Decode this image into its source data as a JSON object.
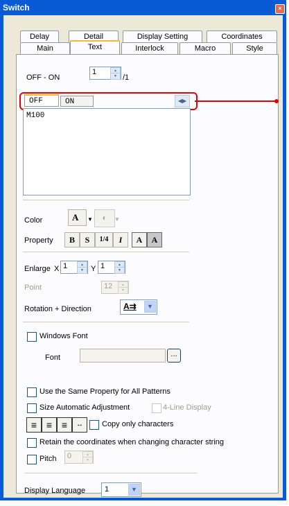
{
  "window": {
    "title": "Switch",
    "close_glyph": "×"
  },
  "tabs_row1": [
    "Delay",
    "Detail",
    "Display Setting",
    "Coordinates"
  ],
  "tabs_row2": [
    "Main",
    "Text",
    "Interlock",
    "Macro",
    "Style"
  ],
  "active_tab": "Text",
  "off_on": {
    "label": "OFF - ON",
    "value": "1",
    "total": "/1"
  },
  "subtabs": [
    "OFF",
    "ON"
  ],
  "text_content": "M100",
  "color": {
    "label": "Color",
    "font_glyph": "A"
  },
  "property": {
    "label": "Property",
    "buttons": [
      "B",
      "S",
      "1/4",
      "I",
      "A",
      "A"
    ]
  },
  "enlarge": {
    "label": "Enlarge",
    "x_label": "X",
    "x_value": "1",
    "y_label": "Y",
    "y_value": "1"
  },
  "point": {
    "label": "Point",
    "value": "12"
  },
  "rotation": {
    "label": "Rotation + Direction",
    "glyph": "A⇉"
  },
  "windows_font": {
    "label": "Windows Font"
  },
  "font": {
    "label": "Font",
    "value": "",
    "browse": "..."
  },
  "options": {
    "same_property": "Use the Same Property for All Patterns",
    "size_auto": "Size Automatic Adjustment",
    "four_line": "4-Line Display",
    "copy_only": "Copy only characters",
    "retain": "Retain the coordinates when changing character string",
    "pitch_label": "Pitch",
    "pitch_value": "0"
  },
  "align_icons": [
    "align-left-icon",
    "align-center-icon",
    "align-right-icon",
    "char-spacing-icon"
  ],
  "display_language": {
    "label": "Display Language",
    "value": "1"
  },
  "colors": {
    "title_bar": "#0a5ad6",
    "dialog_bg": "#ece9d8",
    "callout": "#e60000",
    "tab_active_accent": "#f5b73b"
  }
}
